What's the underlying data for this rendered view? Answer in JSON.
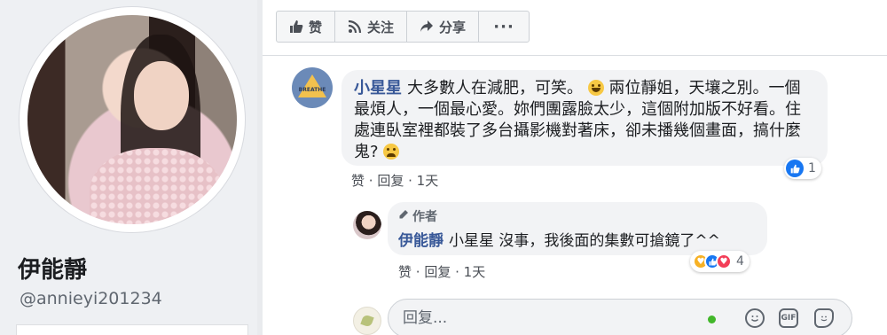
{
  "profile": {
    "name": "伊能靜",
    "handle": "@annieyi201234"
  },
  "actions": {
    "like": "赞",
    "follow": "关注",
    "share": "分享",
    "more": "···"
  },
  "comment": {
    "author": "小星星",
    "avatar_label": "BREATHE",
    "text_1": "大多數人在減肥，可笑。",
    "text_2": "兩位靜姐，天壤之別。一個最煩人，一個最心愛。妳們團露臉太少，這個附加版不好看。住處連臥室裡都裝了多台攝影機對著床，卻未播幾個畫面，搞什麼鬼?",
    "reaction_count": "1",
    "like_label": "赞",
    "reply_label": "回复",
    "time": "1天"
  },
  "reply": {
    "badge": "作者",
    "author": "伊能靜",
    "text": "小星星 沒事，我後面的集數可搶鏡了^^",
    "reaction_count": "4",
    "like_label": "赞",
    "reply_label": "回复",
    "time": "1天"
  },
  "reply_input": {
    "placeholder": "回复...",
    "gif_label": "GIF"
  },
  "colors": {
    "author_link": "#385898",
    "like_blue": "#1877f2",
    "love_red": "#f33e58",
    "online_green": "#42b72a"
  }
}
